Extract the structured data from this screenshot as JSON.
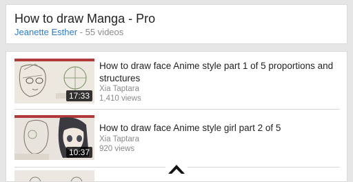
{
  "playlist": {
    "title": "How to draw Manga - Pro",
    "author": "Jeanette Esther",
    "video_count": " - 55 videos"
  },
  "videos": [
    {
      "title": "How to draw face Anime style part 1 of 5 proportions and structures",
      "channel": "Xia Taptara",
      "views": "1,410 views",
      "duration": "17:33"
    },
    {
      "title": "How to draw face Anime style girl part 2 of 5",
      "channel": "Xia Taptara",
      "views": "920 views",
      "duration": "10:37"
    }
  ],
  "icons": {
    "scroll_up": "chevron-up-icon"
  },
  "colors": {
    "author_link": "#2a7cc7",
    "background": "#e6e6e6"
  }
}
